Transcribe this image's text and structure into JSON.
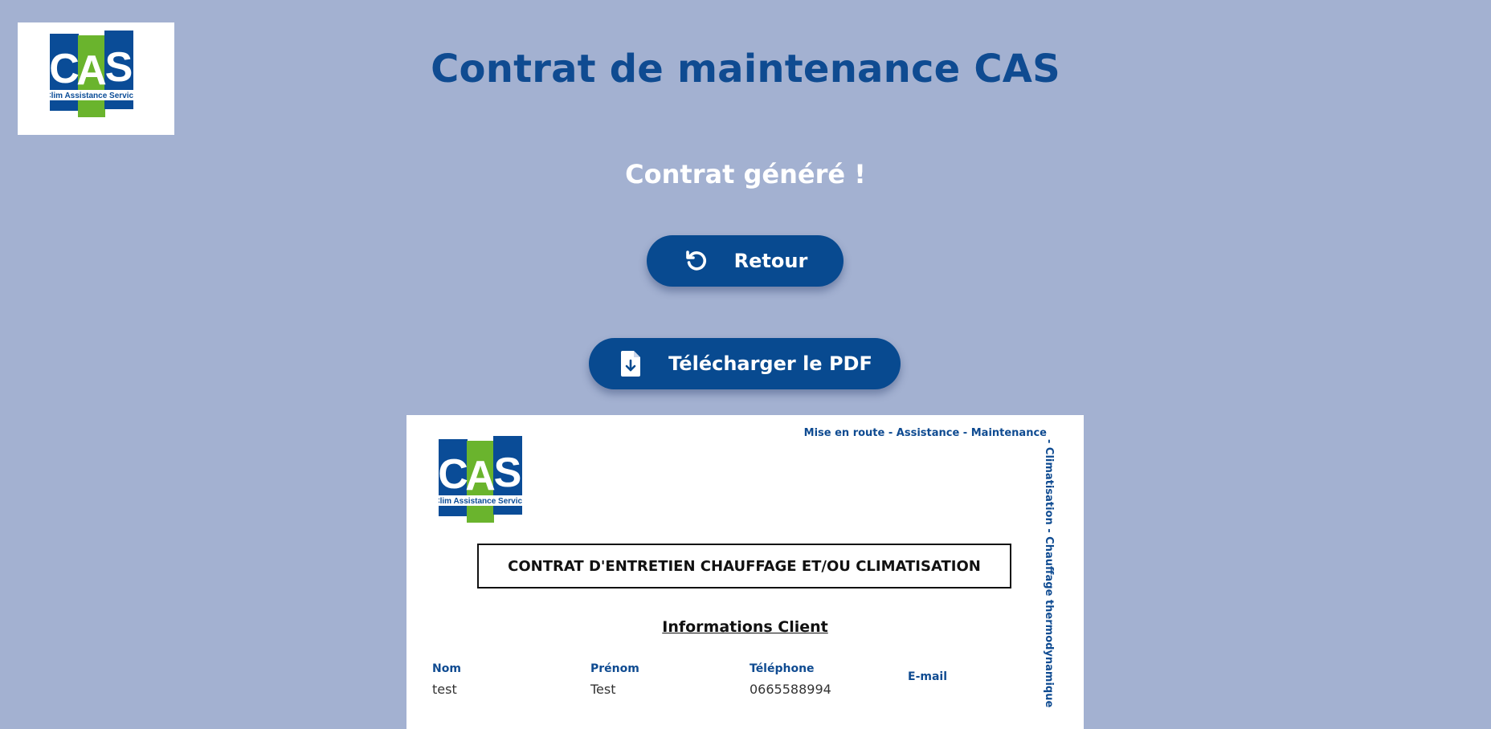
{
  "header": {
    "logo": {
      "letters": [
        "C",
        "A",
        "S"
      ],
      "subtitle": "Clim Assistance Service"
    },
    "title": "Contrat de maintenance CAS"
  },
  "status": {
    "message": "Contrat généré !"
  },
  "actions": {
    "back_label": "Retour",
    "back_icon": "undo-icon",
    "download_label": "Télécharger le PDF",
    "download_icon": "file-download-icon"
  },
  "document": {
    "tagline": "Mise en route - Assistance - Maintenance",
    "side_text": "- Climatisation - Chauffage thermodynamique",
    "heading": "CONTRAT D'ENTRETIEN CHAUFFAGE ET/OU CLIMATISATION",
    "section_title": "Informations Client",
    "client_fields": [
      {
        "label": "Nom",
        "value": "test"
      },
      {
        "label": "Prénom",
        "value": "Test"
      },
      {
        "label": "Téléphone",
        "value": "0665588994"
      },
      {
        "label": "E-mail",
        "value": ""
      }
    ]
  },
  "colors": {
    "background": "#a3b1d1",
    "primary": "#0f4b91",
    "button": "#084a90",
    "logo_blue": "#0a4c97",
    "logo_green": "#6ab42d"
  }
}
